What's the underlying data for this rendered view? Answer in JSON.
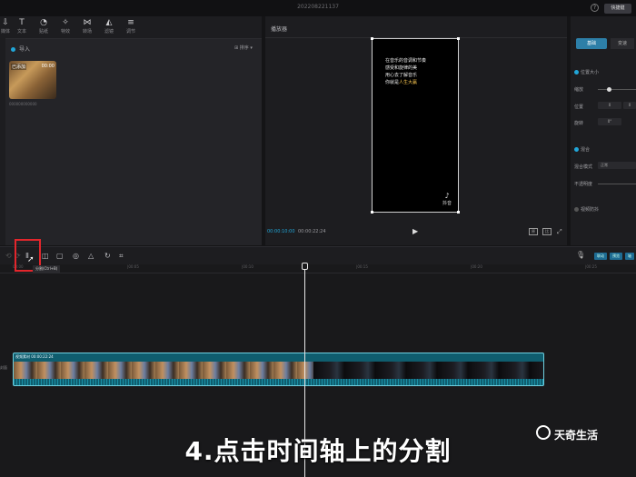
{
  "window": {
    "title": "202208221137",
    "help": "?",
    "export_label": "快捷键"
  },
  "watermark_top": "天奇",
  "media_tools": [
    {
      "icon": "⇩",
      "label": "媒体"
    },
    {
      "icon": "T",
      "label": "文本"
    },
    {
      "icon": "◔",
      "label": "贴纸"
    },
    {
      "icon": "✧",
      "label": "特效"
    },
    {
      "icon": "⋈",
      "label": "转场"
    },
    {
      "icon": "◭",
      "label": "滤镜"
    },
    {
      "icon": "≡",
      "label": "调节"
    }
  ],
  "media": {
    "import_label": "导入",
    "sort_label": "排序",
    "clip_added": "已添加",
    "clip_duration": "00:00",
    "clip_name": "000000000000"
  },
  "player": {
    "header": "播放器",
    "caption_lines": [
      "在音乐的音调和节奏",
      "感受和旋律的美",
      "用心去了解音乐",
      "你就是",
      "人生大赢"
    ],
    "caption_highlight": "人生大赢",
    "tiktok_label": "抖音",
    "time_current": "00:00:10:00",
    "time_total": "00:00:22:24",
    "play": "▶",
    "ratio_a": "原",
    "ratio_b": "比",
    "fullscreen": "⤢"
  },
  "inspector": {
    "tab_active": "基础",
    "tab_other": "变速",
    "position_label": "位置大小",
    "scale_label": "缩放",
    "pos_label": "位置",
    "rotate_label": "旋转",
    "x_val": "0",
    "y_val": "0",
    "rot_val": "0°",
    "blend_label": "混合",
    "mode_label": "混合模式",
    "mode_val": "正常",
    "opacity_label": "不透明度",
    "stabilize_label": "视频防抖"
  },
  "timeline_tools": [
    "⟲",
    "⟳",
    "Ⅱ",
    "◫",
    "▢",
    "◎",
    "△",
    "↻",
    "⌗"
  ],
  "tooltip": "分割(Ctrl+B)",
  "timeline_right": [
    "联动",
    "预览",
    "轴"
  ],
  "ruler_labels": [
    "00:00",
    "|00:05",
    "|00:10",
    "|00:15",
    "|00:20",
    "|00:25"
  ],
  "track": {
    "label": "封面",
    "clip_header": "视频素材  00:00:22:24"
  },
  "caption": "4.点击时间轴上的分割",
  "brand": "天奇生活"
}
